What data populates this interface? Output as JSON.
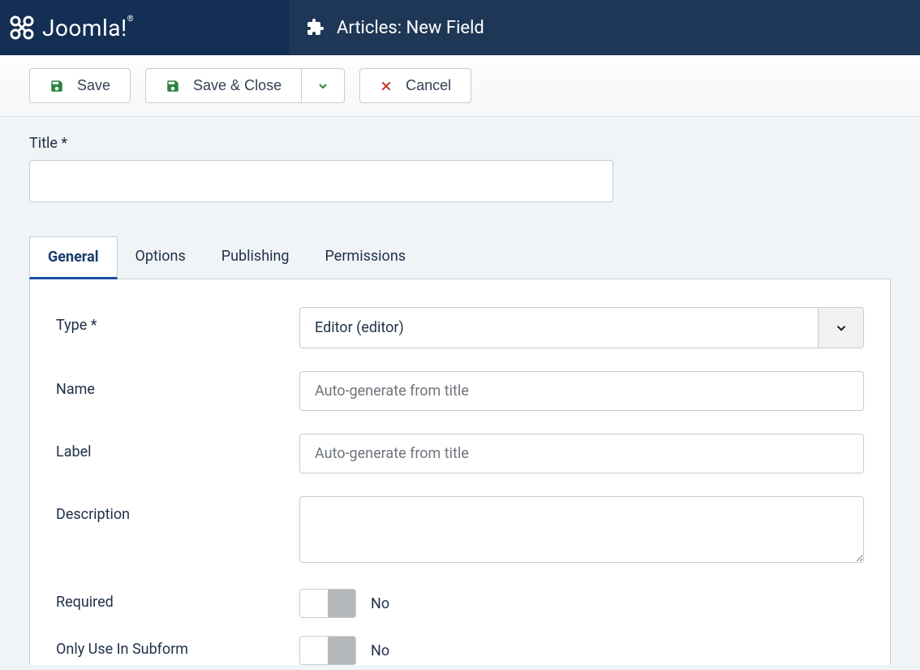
{
  "header": {
    "brand": "Joomla!",
    "page_title": "Articles: New Field"
  },
  "toolbar": {
    "save": "Save",
    "save_close": "Save & Close",
    "cancel": "Cancel"
  },
  "title_field": {
    "label": "Title *",
    "value": ""
  },
  "tabs": {
    "general": "General",
    "options": "Options",
    "publishing": "Publishing",
    "permissions": "Permissions"
  },
  "form": {
    "type": {
      "label": "Type *",
      "value": "Editor (editor)"
    },
    "name": {
      "label": "Name",
      "placeholder": "Auto-generate from title",
      "value": ""
    },
    "f_label": {
      "label": "Label",
      "placeholder": "Auto-generate from title",
      "value": ""
    },
    "description": {
      "label": "Description",
      "value": ""
    },
    "required": {
      "label": "Required",
      "value": "No"
    },
    "subform": {
      "label": "Only Use In Subform",
      "value": "No"
    }
  }
}
